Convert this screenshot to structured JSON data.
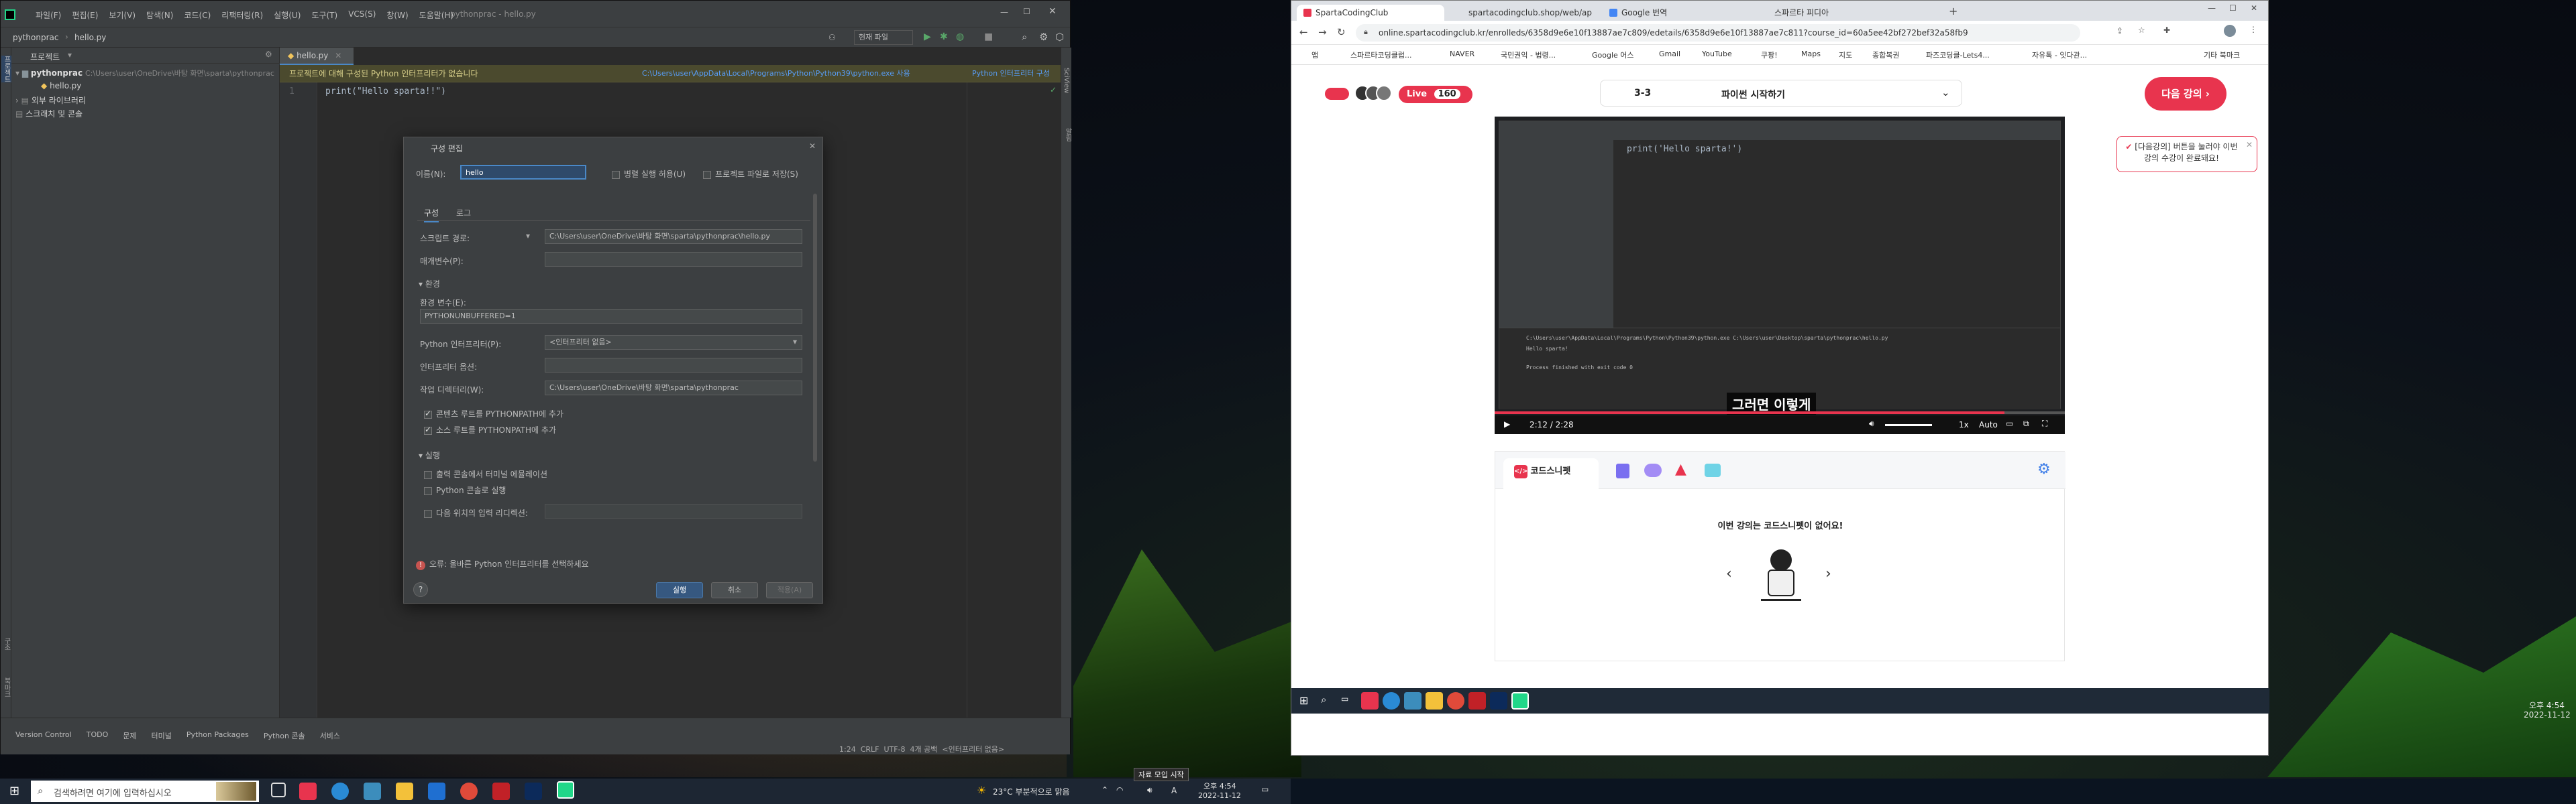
{
  "ide": {
    "menu": [
      "파일(F)",
      "편집(E)",
      "보기(V)",
      "탐색(N)",
      "코드(C)",
      "리팩터링(R)",
      "실행(U)",
      "도구(T)",
      "VCS(S)",
      "창(W)",
      "도움말(H)"
    ],
    "title": "pythonprac - hello.py",
    "breadcrumb_project": "pythonprac",
    "breadcrumb_file": "hello.py",
    "run_config": "현재 파일",
    "project_tool_label": "프로젝트",
    "editor_tab": "hello.py",
    "warning": "프로젝트에 대해 구성된 Python 인터프리터가 없습니다",
    "warning_path": "C:\\Users\\user\\AppData\\Local\\Programs\\Python\\Python39\\python.exe 사용",
    "warning_link": "Python 인터프리터 구성",
    "tree": {
      "root": "pythonprac",
      "root_path": "C:\\Users\\user\\OneDrive\\바탕 화면\\sparta\\pythonprac",
      "file": "hello.py",
      "ext_lib": "외부 라이브러리",
      "scratch": "스크래치 및 콘솔"
    },
    "line_no": "1",
    "code": "print(\"Hello sparta!!\")",
    "bottom_tabs": [
      "Version Control",
      "TODO",
      "문제",
      "터미널",
      "Python Packages",
      "Python 콘솔",
      "서비스"
    ],
    "status_right": "1:24  CRLF  UTF-8  4개 공백  <인터프리터 없음>",
    "left_strip": [
      "프로젝트",
      "구조",
      "북마크"
    ]
  },
  "dialog": {
    "title": "구성 편집",
    "name_label": "이름(N):",
    "name_value": "hello",
    "parallel_label": "병렬 실행 허용(U)",
    "save_project_label": "프로젝트 파일로 저장(S)",
    "tabs": [
      "구성",
      "로그"
    ],
    "script_path_label": "스크립트 경로:",
    "script_path_value": "C:\\Users\\user\\OneDrive\\바탕 화면\\sparta\\pythonprac\\hello.py",
    "params_label": "매개변수(P):",
    "env_section": "환경",
    "env_vars_label": "환경 변수(E):",
    "env_vars_value": "PYTHONUNBUFFERED=1",
    "interp_label": "Python 인터프리터(P):",
    "interp_value": "<인터프리터 없음>",
    "interp_opts_label": "인터프리터 옵션:",
    "workdir_label": "작업 디렉터리(W):",
    "workdir_value": "C:\\Users\\user\\OneDrive\\바탕 화면\\sparta\\pythonprac",
    "add_content_roots": "콘텐츠 루트를 PYTHONPATH에 추가",
    "add_source_roots": "소스 루트를 PYTHONPATH에 추가",
    "exec_section": "실행",
    "emulate_terminal": "출력 콘솔에서 터미널 에뮬레이션",
    "run_with_console": "Python 콘솔로 실행",
    "redirect_input": "다음 위치의 입력 리디렉션:",
    "error_text": "오류: 올바른 Python 인터프리터를 선택하세요",
    "run_btn": "실행",
    "cancel_btn": "취소",
    "apply_btn": "적용(A)",
    "help": "?"
  },
  "browser": {
    "tabs": [
      "SpartaCodingClub",
      "spartacodingclub.shop/web/ap",
      "Google 번역",
      "스파르타 피디아"
    ],
    "url": "online.spartacodingclub.kr/enrolleds/6358d9e6e10f13887ae7c809/edetails/6358d9e6e10f13887ae7c811?course_id=60a5ee42bf272bef32a58fb9",
    "bookmarks": [
      "앱",
      "스파르타코딩클럽...",
      "NAVER",
      "국민권익 - 법령...",
      "Google 어스",
      "Gmail",
      "YouTube",
      "쿠팡!",
      "Maps",
      "지도",
      "종합복권",
      "파즈코딩클-Lets4...",
      "자유톡 - 잇다관...",
      "기타 북마크"
    ],
    "live_label": "Live",
    "live_count": "160",
    "lesson_num": "3-3",
    "lesson_title": "파이썬 시작하기",
    "next_btn": "다음 강의",
    "tooltip": "[다음강의] 버튼을 눌러야 이번 강의 수강이 완료돼요!",
    "video_subtitle": "그러면 이렇게",
    "time_current": "2:12",
    "time_sep": "/",
    "time_total": "2:28",
    "speed": "1x",
    "quality": "Auto",
    "progress": 0.894,
    "snippet_tab": "코드스니펫",
    "empty_msg": "이번 강의는 코드스니펫이 없어요!",
    "video_code": "print('Hello sparta!')",
    "video_console": [
      "C:\\Users\\user\\AppData\\Local\\Programs\\Python\\Python39\\python.exe C:\\Users\\user\\Desktop\\sparta\\pythonprac\\hello.py",
      "Hello sparta!",
      "Process finished with exit code 0"
    ],
    "clock_time": "오후 4:54",
    "clock_date": "2022-11-12"
  },
  "taskbar": {
    "search_placeholder": "검색하려면 여기에 입력하십시오",
    "weather": "23°C 부분적으로 맑음",
    "lang": "A",
    "time": "오후 4:54",
    "date": "2022-11-12",
    "tooltip": "자료 모입 시작",
    "right_time": "오후 4:54",
    "right_date": "2022-11-12"
  }
}
